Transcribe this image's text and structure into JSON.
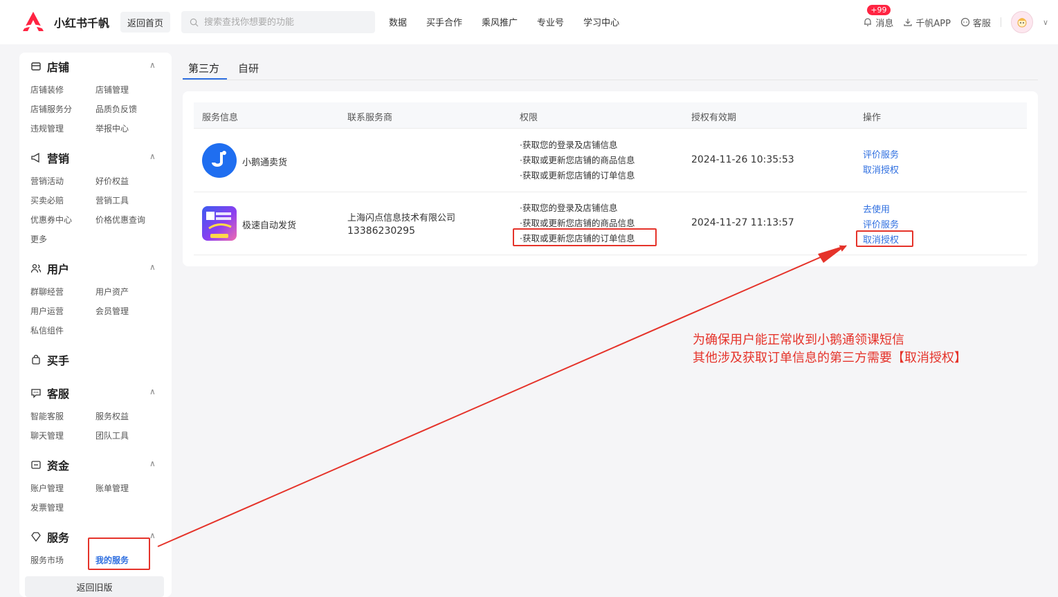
{
  "topbar": {
    "brand": "小红书千帆",
    "home_label": "返回首页",
    "search_placeholder": "搜索查找你想要的功能",
    "nav": [
      "数据",
      "买手合作",
      "乘风推广",
      "专业号",
      "学习中心"
    ],
    "messages_label": "消息",
    "messages_badge": "+99",
    "app_label": "千帆APP",
    "service_label": "客服"
  },
  "sidebar": {
    "groups": [
      {
        "title": "店铺",
        "items": [
          "店铺装修",
          "店铺管理",
          "店铺服务分",
          "品质负反馈",
          "违规管理",
          "举报中心"
        ]
      },
      {
        "title": "营销",
        "items": [
          "营销活动",
          "好价权益",
          "买卖必赔",
          "营销工具",
          "优惠券中心",
          "价格优惠查询",
          "更多"
        ]
      },
      {
        "title": "用户",
        "items": [
          "群聊经营",
          "用户资产",
          "用户运营",
          "会员管理",
          "私信组件"
        ]
      },
      {
        "title": "买手",
        "items": []
      },
      {
        "title": "客服",
        "items": [
          "智能客服",
          "服务权益",
          "聊天管理",
          "团队工具"
        ]
      },
      {
        "title": "资金",
        "items": [
          "账户管理",
          "账单管理",
          "发票管理"
        ]
      },
      {
        "title": "服务",
        "items": [
          "服务市场",
          "我的服务"
        ]
      }
    ],
    "back_old": "返回旧版"
  },
  "tabs": [
    "第三方",
    "自研"
  ],
  "table": {
    "headers": [
      "服务信息",
      "联系服务商",
      "权限",
      "授权有效期",
      "操作"
    ],
    "rows": [
      {
        "name": "小鹅通卖货",
        "provider": "",
        "phone": "",
        "perms": [
          "·获取您的登录及店铺信息",
          "·获取或更新您店铺的商品信息",
          "·获取或更新您店铺的订单信息"
        ],
        "expiry": "2024-11-26 10:35:53",
        "actions": [
          "评价服务",
          "取消授权"
        ]
      },
      {
        "name": "极速自动发货",
        "provider": "上海闪点信息技术有限公司",
        "phone": "13386230295",
        "perms": [
          "·获取您的登录及店铺信息",
          "·获取或更新您店铺的商品信息",
          "·获取或更新您店铺的订单信息"
        ],
        "expiry": "2024-11-27 11:13:57",
        "actions": [
          "去使用",
          "评价服务",
          "取消授权"
        ]
      }
    ]
  },
  "annotation": {
    "line1": "为确保用户能正常收到小鹅通领课短信",
    "line2": "其他涉及获取订单信息的第三方需要【取消授权】",
    "color": "#e5332a"
  },
  "colors": {
    "accent": "#2f6fe0",
    "brand": "#ff2442"
  }
}
